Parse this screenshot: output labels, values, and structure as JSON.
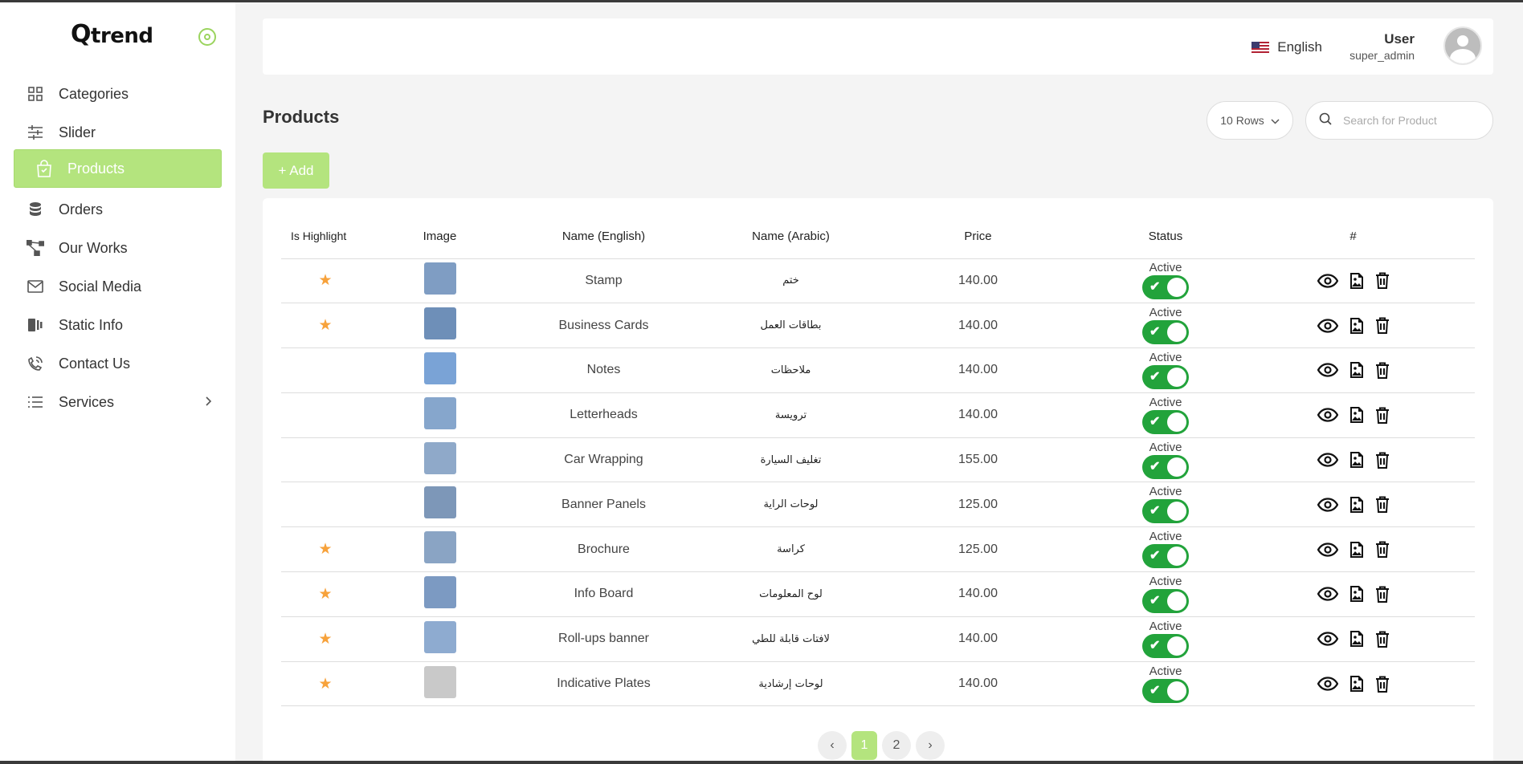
{
  "brand": {
    "logo_text": "trend",
    "logo_mark": "Q"
  },
  "sidebar": {
    "items": [
      {
        "label": "Categories",
        "icon": "grid-icon"
      },
      {
        "label": "Slider",
        "icon": "sliders-icon"
      },
      {
        "label": "Products",
        "icon": "shopping-bag-icon",
        "active": true
      },
      {
        "label": "Orders",
        "icon": "database-icon"
      },
      {
        "label": "Our Works",
        "icon": "workflow-icon"
      },
      {
        "label": "Social Media",
        "icon": "mail-icon"
      },
      {
        "label": "Static Info",
        "icon": "panel-icon"
      },
      {
        "label": "Contact Us",
        "icon": "phone-signal-icon"
      },
      {
        "label": "Services",
        "icon": "list-icon",
        "has_submenu": true
      }
    ]
  },
  "header": {
    "language": "English",
    "user_name": "User",
    "user_role": "super_admin"
  },
  "page": {
    "title": "Products",
    "rows_select": "10 Rows",
    "search_placeholder": "Search for Product",
    "add_label": "+ Add"
  },
  "table": {
    "headers": {
      "highlight": "Is Highlight",
      "image": "Image",
      "name_en": "Name (English)",
      "name_ar": "Name (Arabic)",
      "price": "Price",
      "status": "Status",
      "actions": "#"
    },
    "rows": [
      {
        "highlight": true,
        "name_en": "Stamp",
        "name_ar": "ختم",
        "price": "140.00",
        "status": "Active",
        "thumb_color": "#7f9dc3"
      },
      {
        "highlight": true,
        "name_en": "Business Cards",
        "name_ar": "بطاقات العمل",
        "price": "140.00",
        "status": "Active",
        "thumb_color": "#6e8fb8"
      },
      {
        "highlight": false,
        "name_en": "Notes",
        "name_ar": "ملاحظات",
        "price": "140.00",
        "status": "Active",
        "thumb_color": "#7aa3d6"
      },
      {
        "highlight": false,
        "name_en": "Letterheads",
        "name_ar": "ترويسة",
        "price": "140.00",
        "status": "Active",
        "thumb_color": "#86a6cc"
      },
      {
        "highlight": false,
        "name_en": "Car Wrapping",
        "name_ar": "تغليف السيارة",
        "price": "155.00",
        "status": "Active",
        "thumb_color": "#8fa9c9"
      },
      {
        "highlight": false,
        "name_en": "Banner Panels",
        "name_ar": "لوحات الراية",
        "price": "125.00",
        "status": "Active",
        "thumb_color": "#7d97b8"
      },
      {
        "highlight": true,
        "name_en": "Brochure",
        "name_ar": "كراسة",
        "price": "125.00",
        "status": "Active",
        "thumb_color": "#8aa4c4"
      },
      {
        "highlight": true,
        "name_en": "Info Board",
        "name_ar": "لوح المعلومات",
        "price": "140.00",
        "status": "Active",
        "thumb_color": "#7c9ac2"
      },
      {
        "highlight": true,
        "name_en": "Roll-ups banner",
        "name_ar": "لافتات قابلة للطي",
        "price": "140.00",
        "status": "Active",
        "thumb_color": "#8eabd0"
      },
      {
        "highlight": true,
        "name_en": "Indicative Plates",
        "name_ar": "لوحات إرشادية",
        "price": "140.00",
        "status": "Active",
        "thumb_color": "#c9c9c9"
      }
    ]
  },
  "pagination": {
    "prev": "‹",
    "pages": [
      "1",
      "2"
    ],
    "current": "1",
    "next": "›"
  },
  "colors": {
    "accent": "#b4e47e",
    "toggle_on": "#22a33b",
    "star": "#f7a23b"
  }
}
